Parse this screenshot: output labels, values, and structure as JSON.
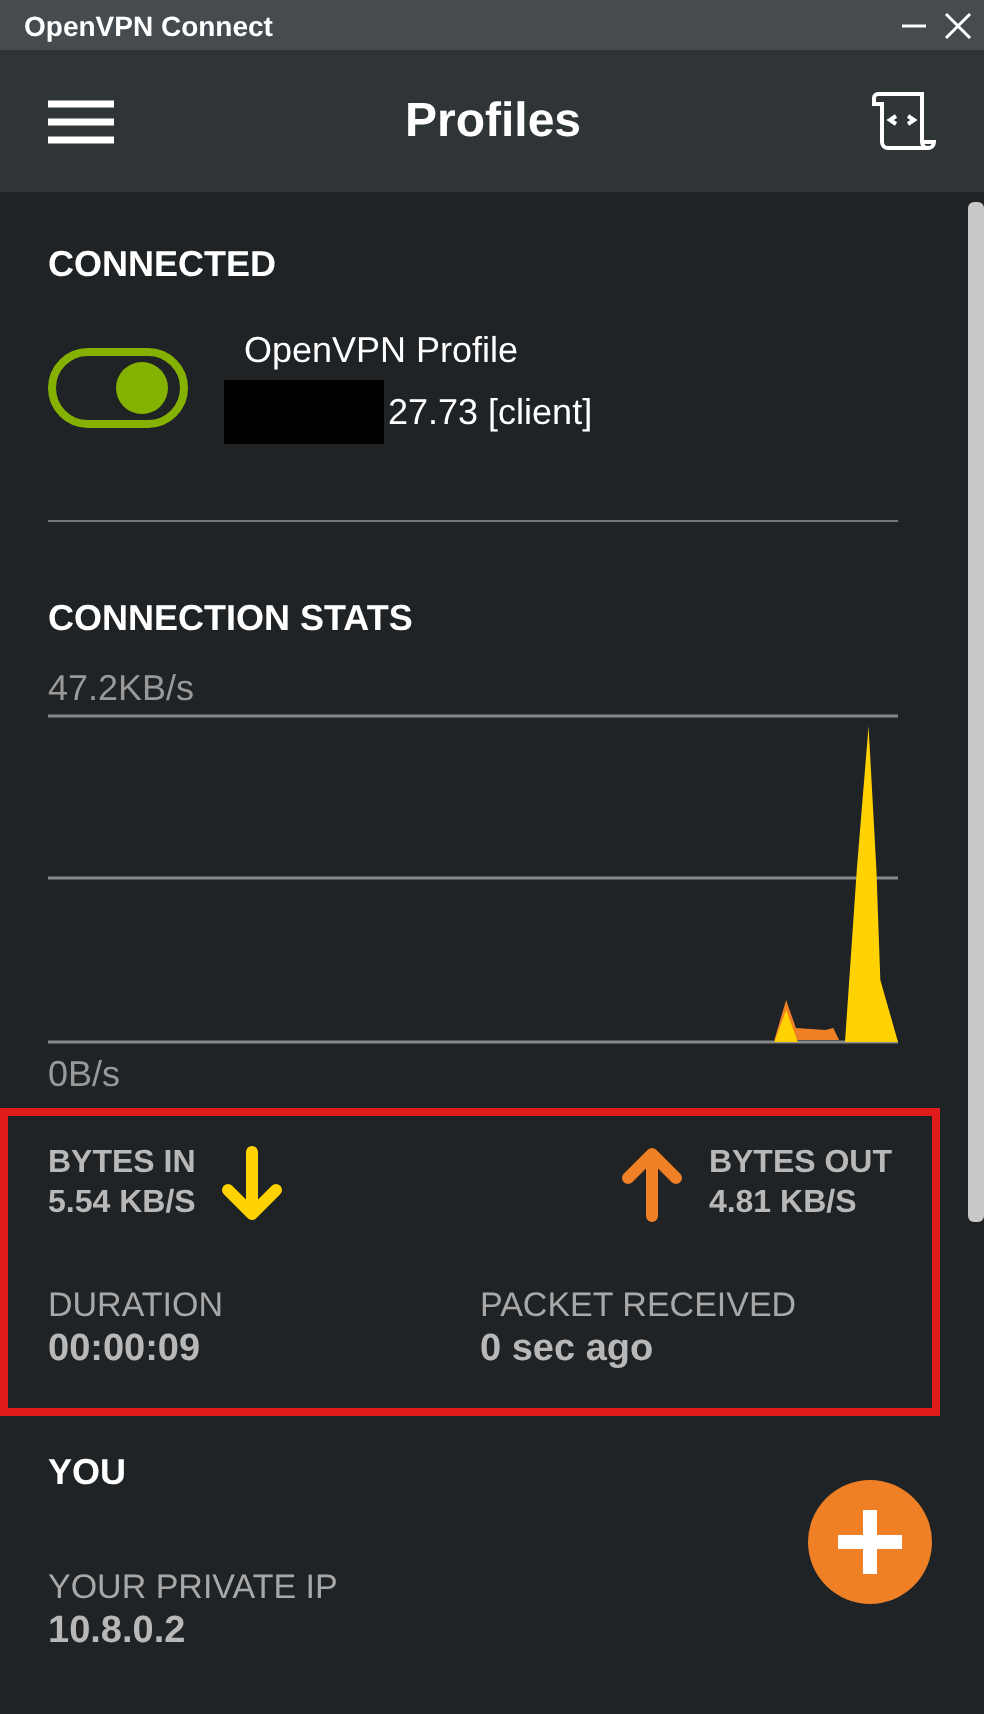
{
  "window": {
    "title": "OpenVPN Connect"
  },
  "header": {
    "title": "Profiles"
  },
  "connected": {
    "heading": "CONNECTED",
    "profile": {
      "name": "OpenVPN Profile",
      "address": "27.73 [client]",
      "address_redacted": true,
      "on": true
    }
  },
  "stats": {
    "heading": "CONNECTION STATS",
    "chart_max": "47.2KB/s",
    "chart_min": "0B/s",
    "highlighted": true,
    "bytes_in": {
      "label": "BYTES IN",
      "value": "5.54 KB/S"
    },
    "bytes_out": {
      "label": "BYTES OUT",
      "value": "4.81 KB/S"
    },
    "duration": {
      "label": "DURATION",
      "value": "00:00:09"
    },
    "packet_received": {
      "label": "PACKET RECEIVED",
      "value": "0 sec ago"
    }
  },
  "you": {
    "heading": "YOU",
    "private_ip": {
      "label": "YOUR PRIVATE IP",
      "value": "10.8.0.2"
    }
  }
}
